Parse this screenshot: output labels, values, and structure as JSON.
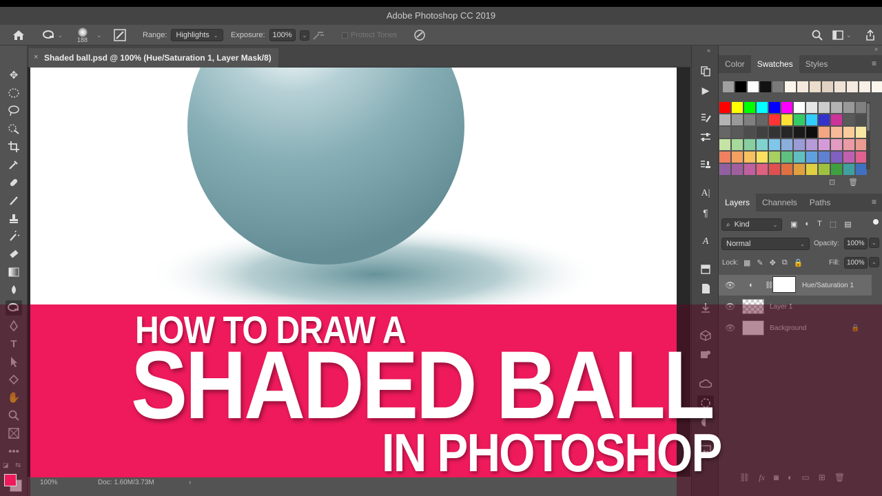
{
  "app": {
    "title": "Adobe Photoshop CC 2019"
  },
  "options": {
    "brush_size": "188",
    "range_label": "Range:",
    "range_value": "Highlights",
    "exposure_label": "Exposure:",
    "exposure_value": "100%",
    "protect_tones": "Protect Tones"
  },
  "document": {
    "tab_title": "Shaded ball.psd @ 100% (Hue/Saturation 1, Layer Mask/8)",
    "close_glyph": "×"
  },
  "status": {
    "zoom": "100%",
    "doc": "Doc: 1.60M/3.73M",
    "arrow": "›"
  },
  "swatches_panel": {
    "tabs": [
      "Color",
      "Swatches",
      "Styles"
    ],
    "active_tab": "Swatches",
    "recent": [
      "#a0a0a0",
      "#000000",
      "#ffffff",
      "#111111",
      "#7a7a7a",
      "#fbf5ec",
      "#f4e9dc",
      "#ebdccb",
      "#e2d2c3",
      "#efe3d6",
      "#f5eadf",
      "#f8f0e6",
      "#fbf6ee"
    ],
    "rows": [
      [
        "#ff0000",
        "#ffff00",
        "#00ff00",
        "#00ffff",
        "#0000ff",
        "#ff00ff",
        "#ffffff",
        "#e6e6e6",
        "#cccccc",
        "#b3b3b3",
        "#999999",
        "#808080"
      ],
      [
        "#b3b3b3",
        "#999999",
        "#808080",
        "#666666",
        "#ff3333",
        "#ffe033",
        "#33cc66",
        "#33ccff",
        "#3333cc",
        "#cc3399",
        "#5a5a5a",
        "#4d4d4d"
      ],
      [
        "#666666",
        "#595959",
        "#4d4d4d",
        "#404040",
        "#333333",
        "#262626",
        "#1a1a1a",
        "#0d0d0d",
        "#f4a582",
        "#f6b99a",
        "#f9cd9b",
        "#f7e8a3"
      ],
      [
        "#c4e3a5",
        "#a6d99b",
        "#87cfa0",
        "#80d2cf",
        "#7fc6ea",
        "#8aaede",
        "#9b9bd8",
        "#b59bd8",
        "#d59bd8",
        "#e39bc2",
        "#ea9ba6",
        "#ec9b91"
      ],
      [
        "#f08060",
        "#f4a060",
        "#f8c060",
        "#fbe060",
        "#a8d060",
        "#60c080",
        "#60c0c0",
        "#60a0e0",
        "#6080d0",
        "#8060c0",
        "#c060b0",
        "#e06090"
      ],
      [
        "#9060a0",
        "#a060a0",
        "#c060a0",
        "#e06080",
        "#e05050",
        "#e07040",
        "#e0a040",
        "#e0d040",
        "#a0c040",
        "#40a040",
        "#40a0a0",
        "#4070c0"
      ]
    ]
  },
  "layers_panel": {
    "tabs": [
      "Layers",
      "Channels",
      "Paths"
    ],
    "active_tab": "Layers",
    "kind_label": "Kind",
    "blend_mode": "Normal",
    "opacity_label": "Opacity:",
    "opacity_value": "100%",
    "lock_label": "Lock:",
    "fill_label": "Fill:",
    "fill_value": "100%",
    "layers": [
      {
        "name": "Hue/Saturation 1",
        "selected": true
      },
      {
        "name": "Layer 1",
        "selected": false
      },
      {
        "name": "Background",
        "selected": false,
        "locked": true
      }
    ]
  },
  "overlay": {
    "line1": "HOW TO DRAW A",
    "line2": "SHADED BALL",
    "line3": "IN PHOTOSHOP",
    "banner_color": "#ee1a5b"
  },
  "colors": {
    "foreground": "#ee1a5b",
    "background": "#ffffff",
    "ball": "#7aa3ab"
  }
}
